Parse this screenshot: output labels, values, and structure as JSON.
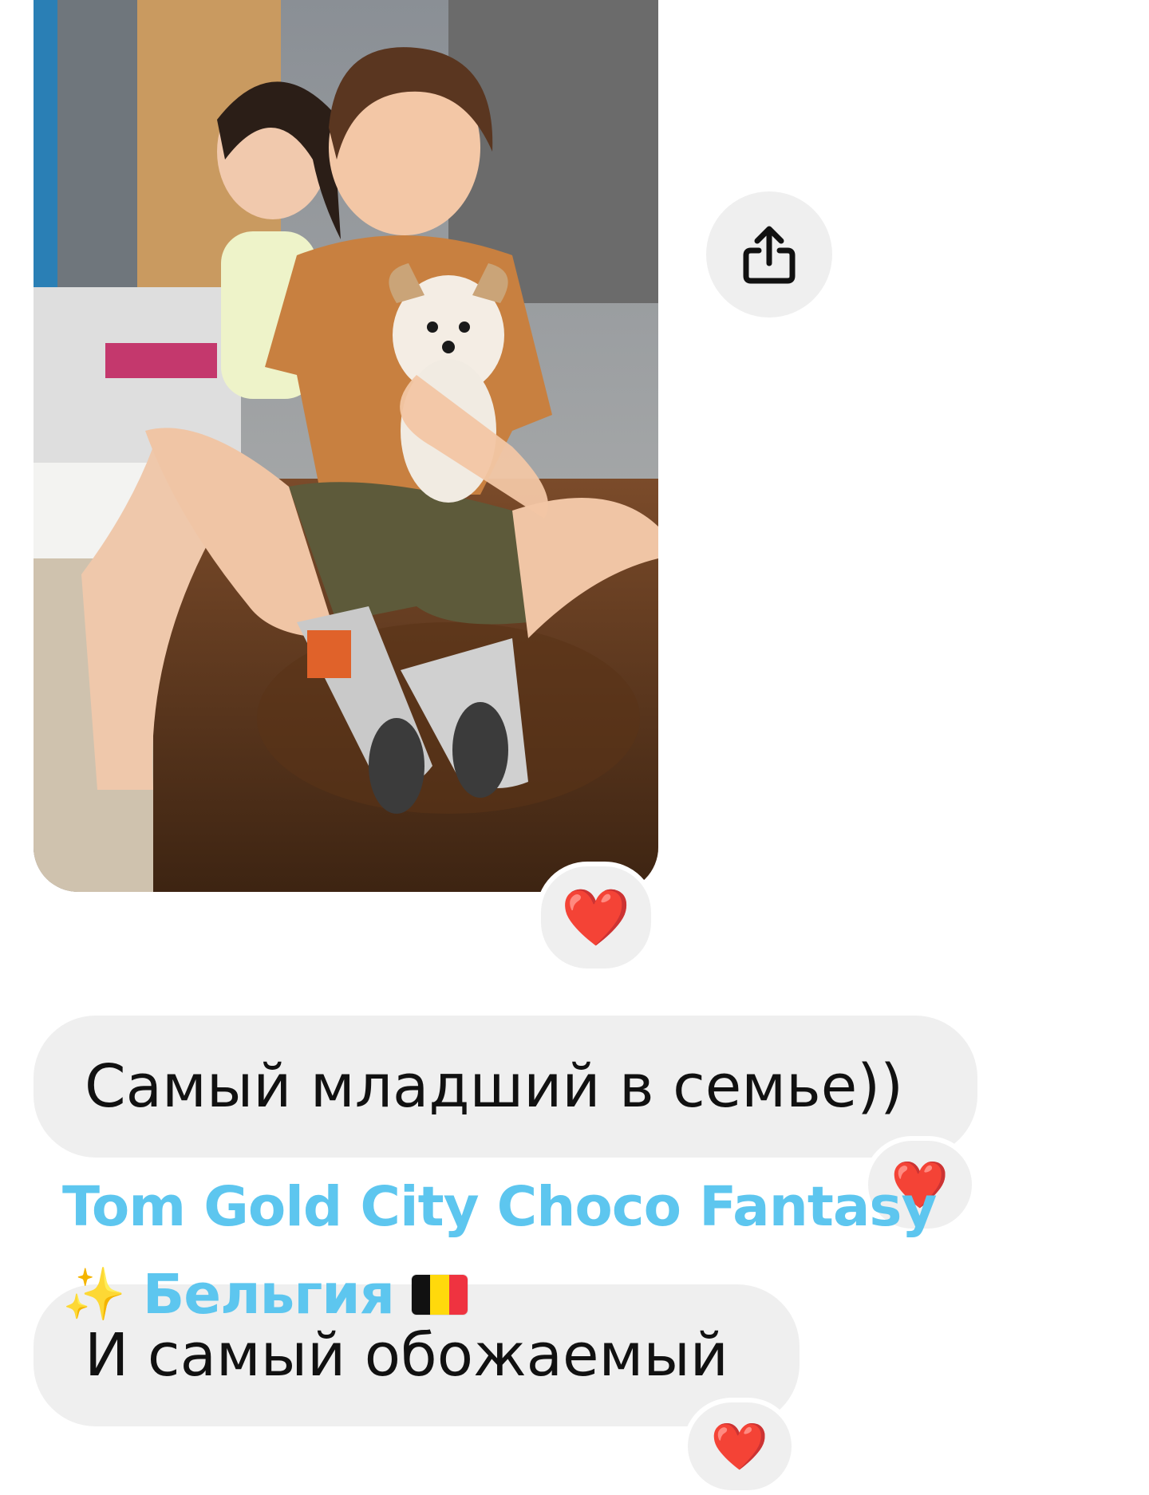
{
  "thread": {
    "photo_message": {
      "reaction_emoji": "❤️"
    },
    "share_button": {
      "icon": "share-icon"
    },
    "messages": [
      {
        "text": "Самый младший в семье))",
        "reaction_emoji": "❤️"
      },
      {
        "text": "И самый обожаемый",
        "reaction_emoji": "❤️"
      }
    ]
  },
  "overlay_caption": {
    "line1": "Tom Gold City Choco Fantasy",
    "sparkles": "✨",
    "line2": "Бельгия",
    "flag_colors": [
      "#111111",
      "#ffd90c",
      "#ef3340"
    ]
  },
  "colors": {
    "bubble": "#efefef",
    "caption": "#5dc6ef",
    "heart": "#e0142d"
  }
}
